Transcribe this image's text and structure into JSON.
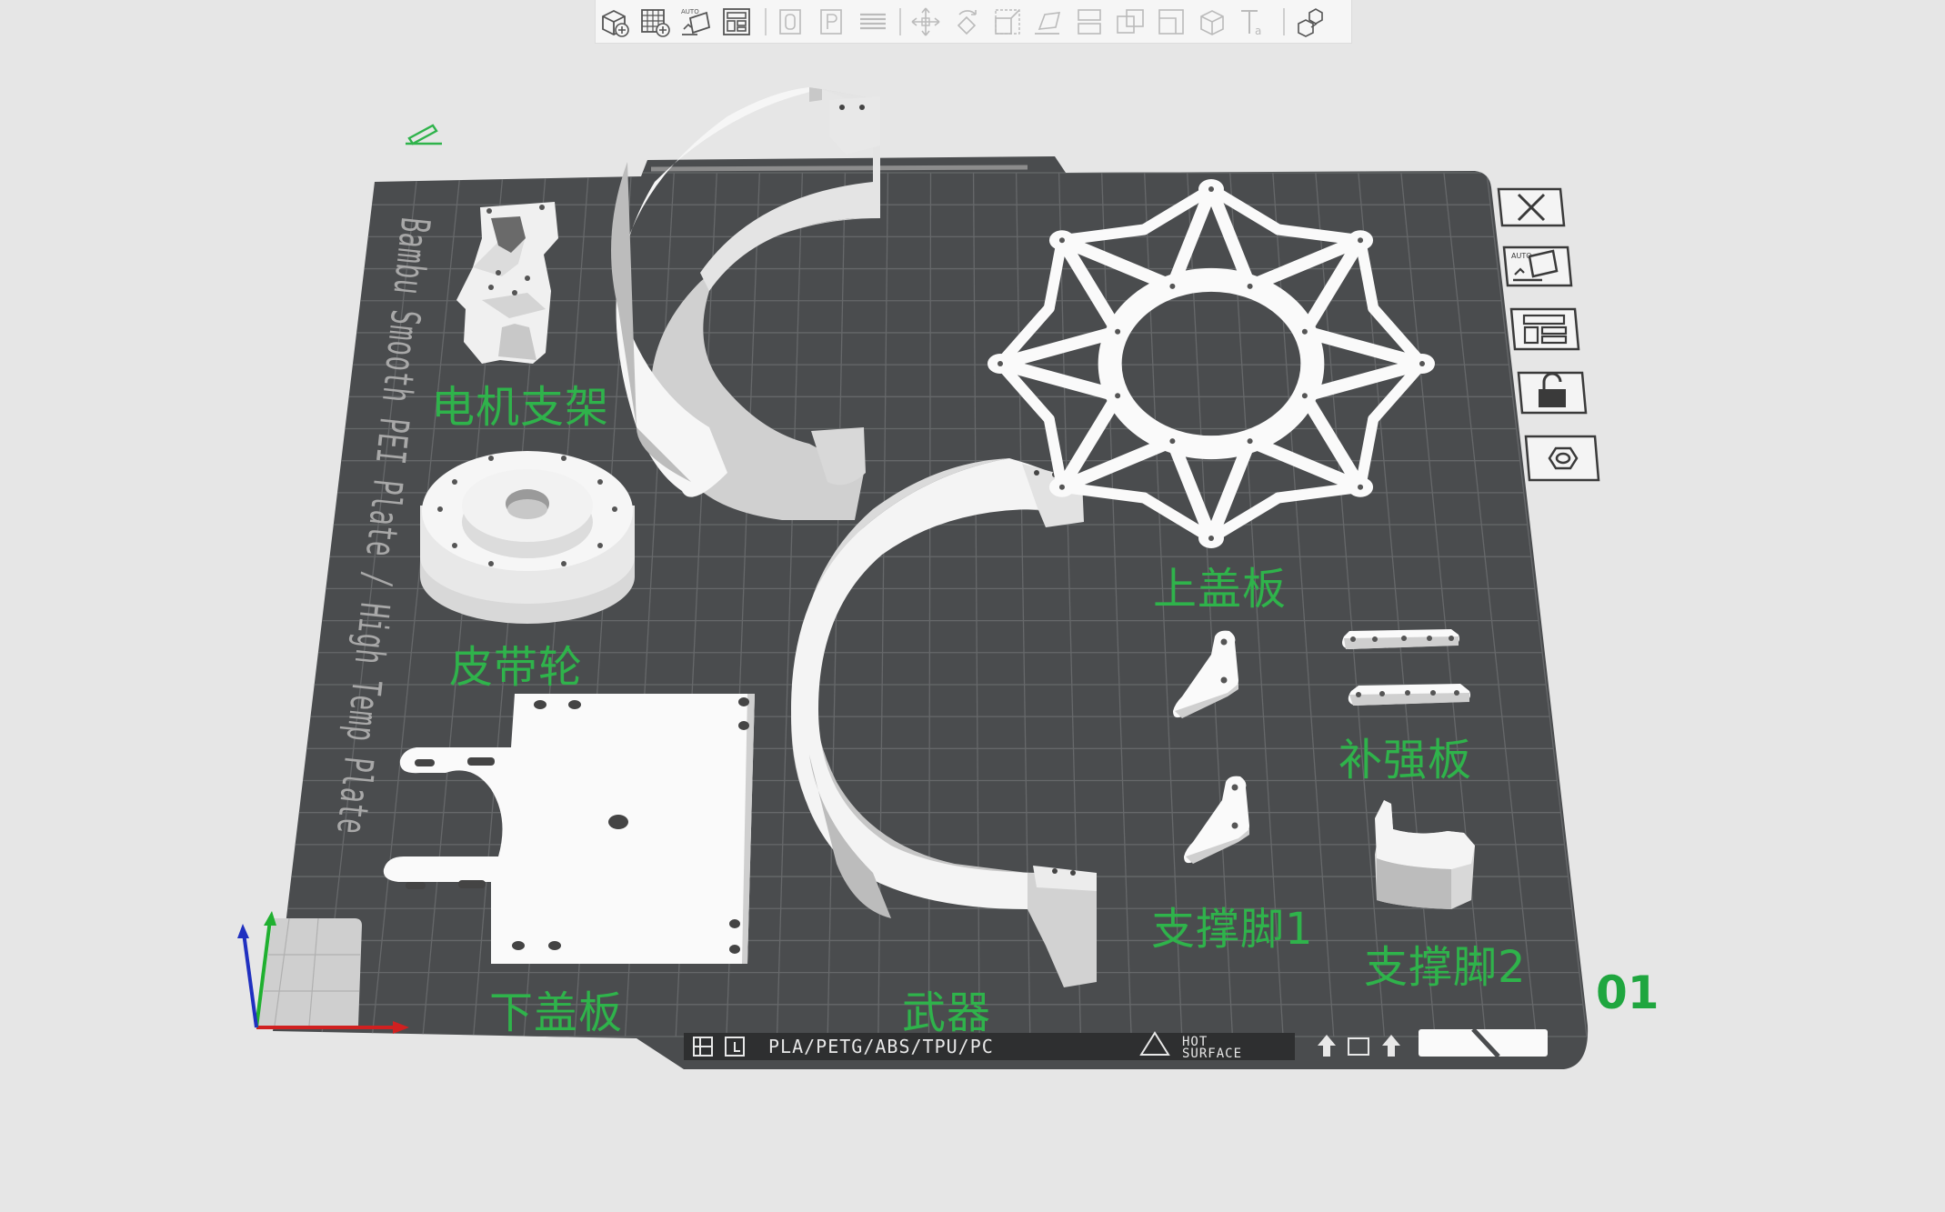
{
  "toolbar": {
    "buttons": [
      {
        "name": "add-object-icon"
      },
      {
        "name": "add-plate-icon"
      },
      {
        "name": "auto-orient-icon"
      },
      {
        "name": "arrange-icon"
      },
      {
        "name": "split-objects-icon"
      },
      {
        "name": "split-parts-icon"
      },
      {
        "name": "layers-icon"
      },
      {
        "name": "move-icon"
      },
      {
        "name": "rotate-icon"
      },
      {
        "name": "scale-icon"
      },
      {
        "name": "lay-on-face-icon"
      },
      {
        "name": "cut-icon"
      },
      {
        "name": "boolean-icon"
      },
      {
        "name": "support-paint-icon"
      },
      {
        "name": "seam-paint-icon"
      },
      {
        "name": "text-icon"
      },
      {
        "name": "assembly-icon"
      }
    ]
  },
  "plate": {
    "name": "Bambu Smooth PEI Plate / High Temp Plate",
    "number": "01",
    "materials": "PLA/PETG/ABS/TPU/PC",
    "hot_surface_line1": "HOT",
    "hot_surface_line2": "SURFACE"
  },
  "plate_controls": [
    {
      "name": "delete-plate-icon"
    },
    {
      "name": "auto-orient-plate-icon",
      "text": "AUTO"
    },
    {
      "name": "arrange-plate-icon"
    },
    {
      "name": "lock-plate-icon"
    },
    {
      "name": "plate-settings-icon"
    }
  ],
  "parts": [
    {
      "id": "motor-bracket",
      "label": "电机支架"
    },
    {
      "id": "pulley",
      "label": "皮带轮"
    },
    {
      "id": "bottom-cover",
      "label": "下盖板"
    },
    {
      "id": "weapon",
      "label": "武器"
    },
    {
      "id": "top-cover",
      "label": "上盖板"
    },
    {
      "id": "reinforcement-plate",
      "label": "补强板"
    },
    {
      "id": "support-leg-1",
      "label": "支撑脚1"
    },
    {
      "id": "support-leg-2",
      "label": "支撑脚2"
    }
  ],
  "colors": {
    "plate": "#4a4c4e",
    "grid": "#6a6c6e",
    "part": "#f2f2f2",
    "label": "#2fb34b",
    "axis_x": "#d02020",
    "axis_y": "#20b030",
    "axis_z": "#2030c0"
  }
}
